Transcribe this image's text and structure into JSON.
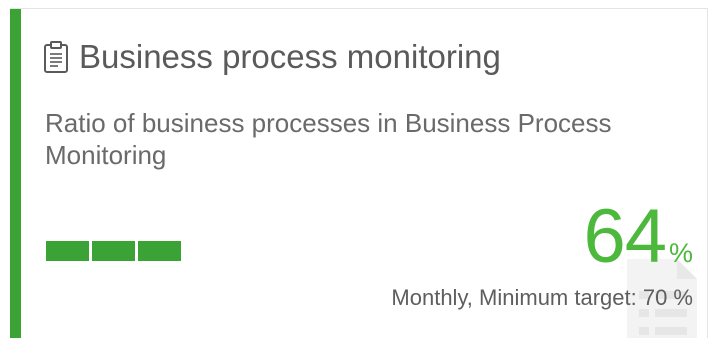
{
  "tile": {
    "title": "Business process monitoring",
    "title_icon": "clipboard-icon",
    "description": "Ratio of business processes in Business Process Monitoring",
    "value": "64",
    "unit": "%",
    "target_text": "Monthly, Minimum target: 70 %",
    "progress_fraction": 0.64,
    "accent_color": "#3ba335",
    "value_color": "#4cb83c",
    "watermark_icon": "document-list-icon"
  }
}
